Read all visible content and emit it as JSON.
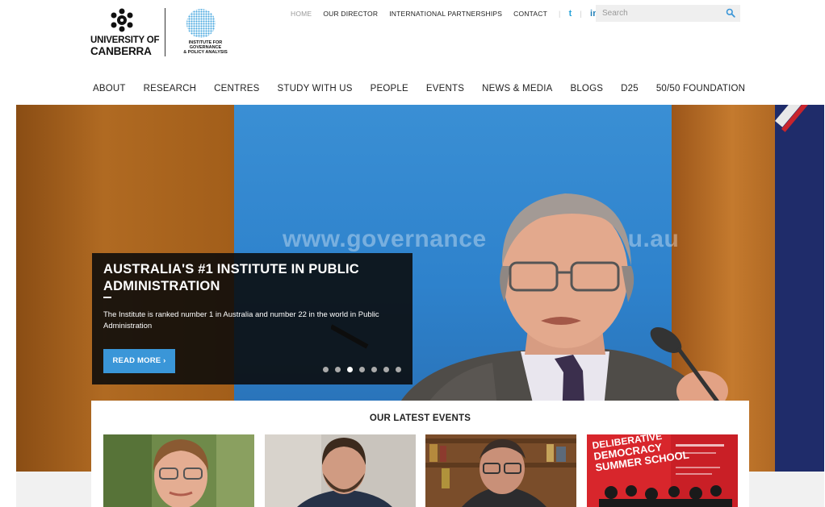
{
  "brand": {
    "university_line1": "UNIVERSITY OF",
    "university_line2": "CANBERRA",
    "institute_lines": [
      "INSTITUTE FOR",
      "GOVERNANCE",
      "& POLICY ANALYSIS"
    ]
  },
  "topnav": {
    "items": [
      "HOME",
      "OUR DIRECTOR",
      "INTERNATIONAL PARTNERSHIPS",
      "CONTACT"
    ],
    "active": "HOME",
    "twitter_glyph": "t",
    "linkedin_glyph": "in"
  },
  "search": {
    "placeholder": "Search",
    "icon": "search-icon"
  },
  "mainnav": {
    "items": [
      "ABOUT",
      "RESEARCH",
      "CENTRES",
      "STUDY WITH US",
      "PEOPLE",
      "EVENTS",
      "NEWS & MEDIA",
      "BLOGS",
      "D25",
      "50/50 FOUNDATION"
    ]
  },
  "hero": {
    "background_text": "www.governance",
    "background_text_tail": "u.au",
    "title": "AUSTRALIA'S #1 INSTITUTE IN PUBLIC ADMINISTRATION",
    "description": "The Institute is ranked number 1 in Australia and number 22 in the world in Public Administration",
    "button_label": "READ MORE ›",
    "slide_count": 7,
    "active_slide": 2
  },
  "events": {
    "heading": "OUR LATEST EVENTS",
    "card4_text": [
      "DELIBERATIVE",
      "DEMOCRACY",
      "SUMMER SCHOOL"
    ]
  },
  "colors": {
    "accent": "#3a96d8",
    "twitter": "#2aa3d9",
    "linkedin": "#1f7fb8",
    "summer_school_red": "#d8262c"
  }
}
